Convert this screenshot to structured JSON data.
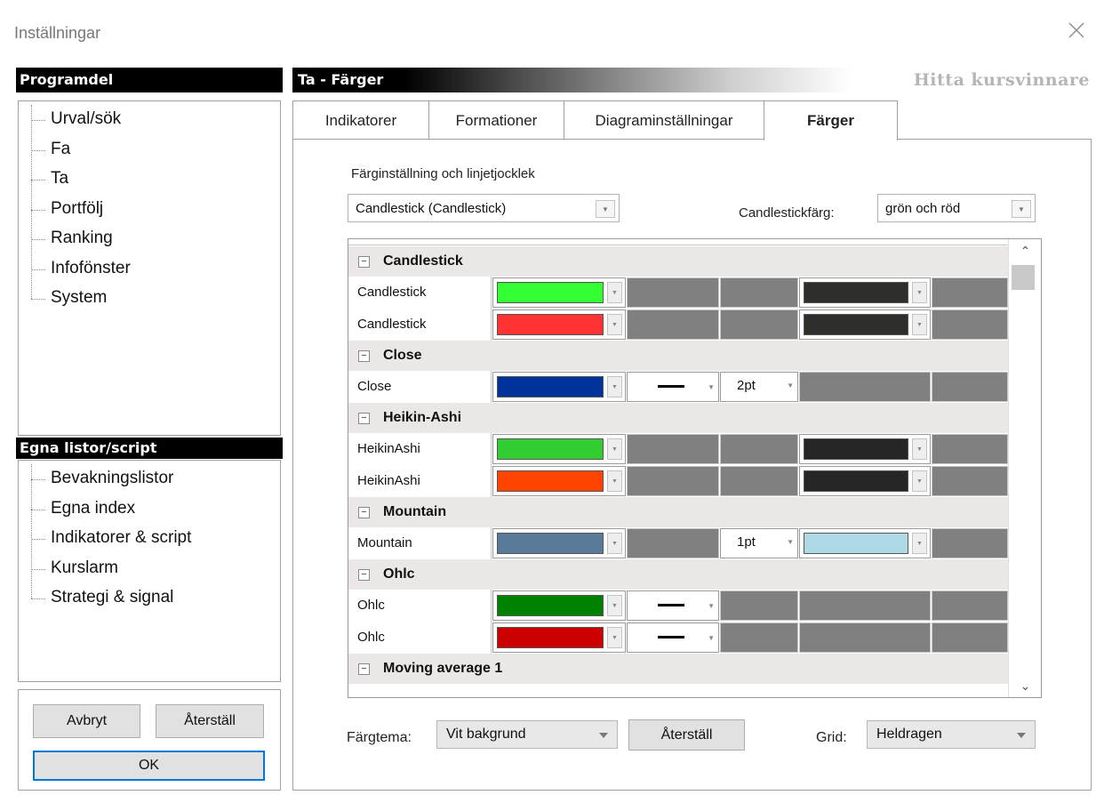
{
  "window": {
    "title": "Inställningar"
  },
  "left": {
    "program_header": "Programdel",
    "program_items": [
      "Urval/sök",
      "Fa",
      "Ta",
      "Portfölj",
      "Ranking",
      "Infofönster",
      "System"
    ],
    "lists_header": "Egna listor/script",
    "lists_items": [
      "Bevakningslistor",
      "Egna index",
      "Indikatorer & script",
      "Kurslarm",
      "Strategi & signal"
    ],
    "cancel_label": "Avbryt",
    "reset_label": "Återställ",
    "ok_label": "OK"
  },
  "right": {
    "header_title": "Ta - Färger",
    "brand": "Hitta kursvinnare",
    "tabs": [
      "Indikatorer",
      "Formationer",
      "Diagraminställningar",
      "Färger"
    ],
    "active_tab": "Färger"
  },
  "settings": {
    "section_label": "Färginställning och linjetjocklek",
    "type_value": "Candlestick (Candlestick)",
    "candle_color_label": "Candlestickfärg:",
    "candle_color_value": "grön och röd"
  },
  "grid": {
    "groups": [
      {
        "name": "Candlestick",
        "rows": [
          {
            "label": "Candlestick",
            "color": "#33ff33",
            "color2": "#2e2e2a"
          },
          {
            "label": "Candlestick",
            "color": "#ff3333",
            "color2": "#2e2e2a"
          }
        ]
      },
      {
        "name": "Close",
        "rows": [
          {
            "label": "Close",
            "color": "#003399",
            "line": true,
            "width": "2pt"
          }
        ]
      },
      {
        "name": "Heikin-Ashi",
        "rows": [
          {
            "label": "HeikinAshi",
            "color": "#33cc33",
            "color2": "#262626"
          },
          {
            "label": "HeikinAshi",
            "color": "#ff4400",
            "color2": "#262626"
          }
        ]
      },
      {
        "name": "Mountain",
        "rows": [
          {
            "label": "Mountain",
            "color": "#5a7a99",
            "width": "1pt",
            "color2": "#add8e6"
          }
        ]
      },
      {
        "name": "Ohlc",
        "rows": [
          {
            "label": "Ohlc",
            "color": "#008000",
            "line": true
          },
          {
            "label": "Ohlc",
            "color": "#cc0000",
            "line": true
          }
        ]
      },
      {
        "name": "Moving average 1",
        "rows": []
      }
    ]
  },
  "bottom": {
    "theme_label": "Färgtema:",
    "theme_value": "Vit bakgrund",
    "reset_label": "Återställ",
    "grid_label": "Grid:",
    "grid_value": "Heldragen"
  }
}
